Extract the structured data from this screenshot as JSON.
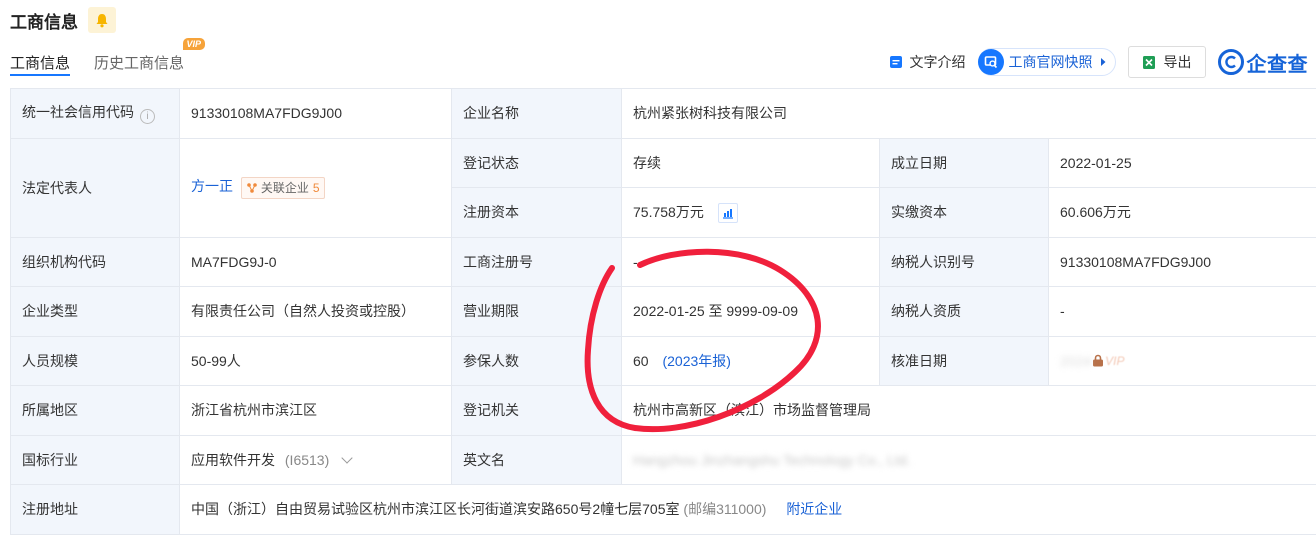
{
  "header": {
    "title": "工商信息"
  },
  "tabs": [
    {
      "label": "工商信息",
      "active": true
    },
    {
      "label": "历史工商信息",
      "badge": "VIP"
    }
  ],
  "toolbar": {
    "text_intro": "文字介绍",
    "quick_snapshot": "工商官网快照",
    "export": "导出",
    "logo": "企查查"
  },
  "info": {
    "credit_code_label": "统一社会信用代码",
    "credit_code": "91330108MA7FDG9J00",
    "company_name_label": "企业名称",
    "company_name": "杭州紧张树科技有限公司",
    "legal_rep_label": "法定代表人",
    "legal_rep": "方一正",
    "related_label": "关联企业",
    "related_count": "5",
    "reg_status_label": "登记状态",
    "reg_status": "存续",
    "founded_label": "成立日期",
    "founded": "2022-01-25",
    "reg_capital_label": "注册资本",
    "reg_capital": "75.758万元",
    "paid_capital_label": "实缴资本",
    "paid_capital": "60.606万元",
    "org_code_label": "组织机构代码",
    "org_code": "MA7FDG9J-0",
    "reg_no_label": "工商注册号",
    "reg_no": "-",
    "taxpayer_id_label": "纳税人识别号",
    "taxpayer_id": "91330108MA7FDG9J00",
    "type_label": "企业类型",
    "type": "有限责任公司（自然人投资或控股）",
    "period_label": "营业期限",
    "period": "2022-01-25 至 9999-09-09",
    "taxpayer_qual_label": "纳税人资质",
    "taxpayer_qual": "-",
    "staff_label": "人员规模",
    "staff": "50-99人",
    "insured_label": "参保人数",
    "insured": "60",
    "insured_year": "(2023年报)",
    "approve_label": "核准日期",
    "approve_vip": "VIP",
    "region_label": "所属地区",
    "region": "浙江省杭州市滨江区",
    "authority_label": "登记机关",
    "authority": "杭州市高新区（滨江）市场监督管理局",
    "industry_label": "国标行业",
    "industry": "应用软件开发",
    "industry_code": "(I6513)",
    "en_name_label": "英文名",
    "en_name": "Hangzhou Jinzhangshu Technology Co., Ltd.",
    "address_label": "注册地址",
    "address": "中国（浙江）自由贸易试验区杭州市滨江区长河街道滨安路650号2幢七层705室",
    "postcode": "(邮编311000)",
    "nearby": "附近企业"
  },
  "colors": {
    "accent": "#1677ff",
    "label_bg": "#f2f6fc",
    "annotation": "#f0203c"
  }
}
